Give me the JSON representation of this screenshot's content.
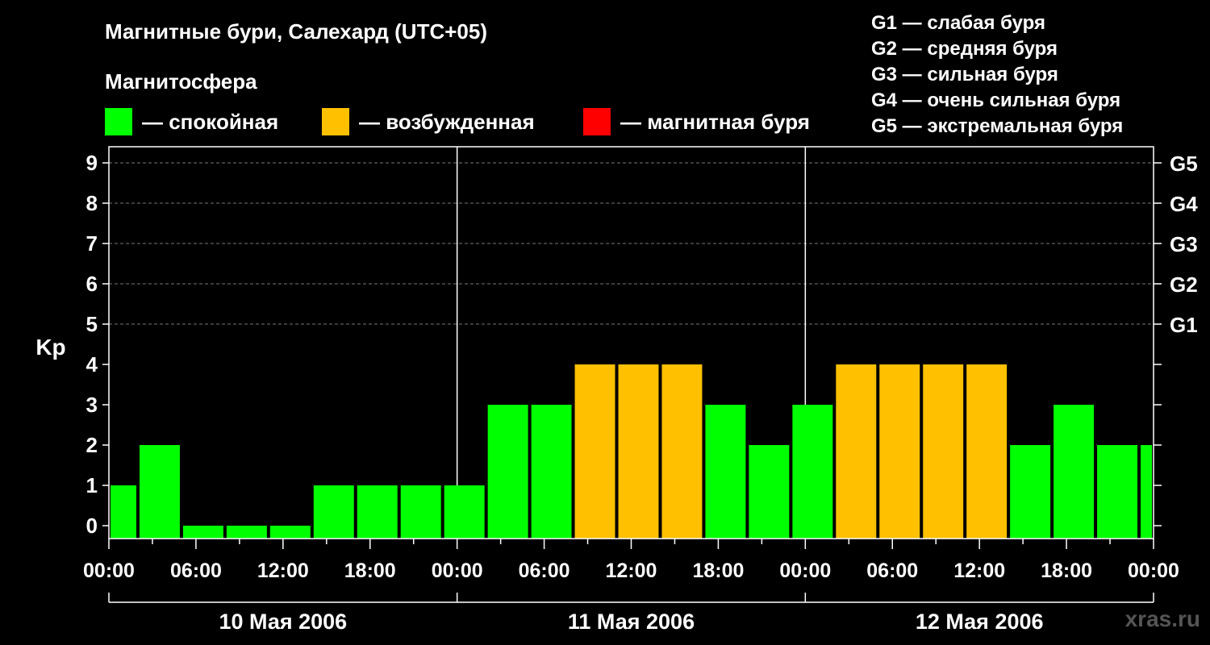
{
  "header": {
    "title": "Магнитные бури, Салехард (UTC+05)",
    "magnetosphere_label": "Магнитосфера"
  },
  "legend": [
    {
      "label": "— спокойная",
      "color": "#00ff00"
    },
    {
      "label": "— возбужденная",
      "color": "#ffc000"
    },
    {
      "label": "— магнитная буря",
      "color": "#ff0000"
    }
  ],
  "g_legend": [
    "G1 — слабая буря",
    "G2 — средняя буря",
    "G3 — сильная буря",
    "G4 — очень сильная буря",
    "G5 — экстремальная буря"
  ],
  "watermark": "xras.ru",
  "chart_data": {
    "type": "bar",
    "title": "Магнитные бури, Салехард (UTC+05)",
    "ylabel": "Kp",
    "ylim": [
      0,
      9
    ],
    "y_ticks": [
      "0",
      "1",
      "2",
      "3",
      "4",
      "5",
      "6",
      "7",
      "8",
      "9"
    ],
    "right_ticks": [
      {
        "kp": 5,
        "label": "G1"
      },
      {
        "kp": 6,
        "label": "G2"
      },
      {
        "kp": 7,
        "label": "G3"
      },
      {
        "kp": 8,
        "label": "G4"
      },
      {
        "kp": 9,
        "label": "G5"
      }
    ],
    "x_range_hours": [
      0,
      72
    ],
    "x_tick_labels": [
      "00:00",
      "06:00",
      "12:00",
      "18:00",
      "00:00",
      "06:00",
      "12:00",
      "18:00",
      "00:00",
      "06:00",
      "12:00",
      "18:00",
      "00:00"
    ],
    "days": [
      "10 Мая 2006",
      "11 Мая 2006",
      "12 Мая 2006"
    ],
    "grid": "dashed horizontal at Kp 5-9",
    "colors": {
      "quiet": "#00ff00",
      "active": "#ffc000",
      "storm": "#ff0000"
    },
    "bars": [
      {
        "start_h": 0,
        "end_h": 2,
        "kp": 1,
        "level": "quiet"
      },
      {
        "start_h": 2,
        "end_h": 5,
        "kp": 2,
        "level": "quiet"
      },
      {
        "start_h": 5,
        "end_h": 8,
        "kp": 0,
        "level": "quiet"
      },
      {
        "start_h": 8,
        "end_h": 11,
        "kp": 0,
        "level": "quiet"
      },
      {
        "start_h": 11,
        "end_h": 14,
        "kp": 0,
        "level": "quiet"
      },
      {
        "start_h": 14,
        "end_h": 17,
        "kp": 1,
        "level": "quiet"
      },
      {
        "start_h": 17,
        "end_h": 20,
        "kp": 1,
        "level": "quiet"
      },
      {
        "start_h": 20,
        "end_h": 23,
        "kp": 1,
        "level": "quiet"
      },
      {
        "start_h": 23,
        "end_h": 26,
        "kp": 1,
        "level": "quiet"
      },
      {
        "start_h": 26,
        "end_h": 29,
        "kp": 3,
        "level": "quiet"
      },
      {
        "start_h": 29,
        "end_h": 32,
        "kp": 3,
        "level": "quiet"
      },
      {
        "start_h": 32,
        "end_h": 35,
        "kp": 4,
        "level": "active"
      },
      {
        "start_h": 35,
        "end_h": 38,
        "kp": 4,
        "level": "active"
      },
      {
        "start_h": 38,
        "end_h": 41,
        "kp": 4,
        "level": "active"
      },
      {
        "start_h": 41,
        "end_h": 44,
        "kp": 3,
        "level": "quiet"
      },
      {
        "start_h": 44,
        "end_h": 47,
        "kp": 2,
        "level": "quiet"
      },
      {
        "start_h": 47,
        "end_h": 50,
        "kp": 3,
        "level": "quiet"
      },
      {
        "start_h": 50,
        "end_h": 53,
        "kp": 4,
        "level": "active"
      },
      {
        "start_h": 53,
        "end_h": 56,
        "kp": 4,
        "level": "active"
      },
      {
        "start_h": 56,
        "end_h": 59,
        "kp": 4,
        "level": "active"
      },
      {
        "start_h": 59,
        "end_h": 62,
        "kp": 4,
        "level": "active"
      },
      {
        "start_h": 62,
        "end_h": 65,
        "kp": 2,
        "level": "quiet"
      },
      {
        "start_h": 65,
        "end_h": 68,
        "kp": 3,
        "level": "quiet"
      },
      {
        "start_h": 68,
        "end_h": 71,
        "kp": 2,
        "level": "quiet"
      },
      {
        "start_h": 71,
        "end_h": 72,
        "kp": 2,
        "level": "quiet"
      }
    ]
  }
}
